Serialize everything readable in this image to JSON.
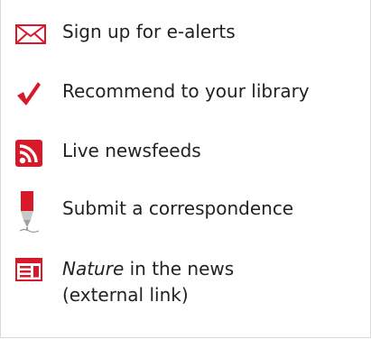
{
  "links": {
    "ealerts": {
      "label": "Sign up for e-alerts",
      "icon": "envelope-icon"
    },
    "recommend": {
      "label": "Recommend to your library",
      "icon": "checkmark-icon"
    },
    "newsfeeds": {
      "label": "Live newsfeeds",
      "icon": "rss-icon"
    },
    "correspondence": {
      "label": "Submit a correspondence",
      "icon": "pen-icon"
    },
    "news": {
      "label_italic": "Nature",
      "label_rest": " in the news",
      "label_line2": "(external link)",
      "icon": "newspaper-icon"
    }
  },
  "colors": {
    "accent": "#d7192a",
    "text": "#222222",
    "border": "#d9d9d9"
  }
}
